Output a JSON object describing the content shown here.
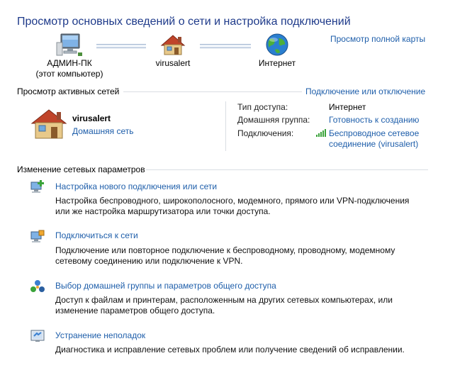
{
  "header": {
    "title": "Просмотр основных сведений о сети и настройка подключений",
    "full_map_link": "Просмотр полной карты"
  },
  "network_map": {
    "computer_name": "АДМИН-ПК",
    "computer_subtitle": "(этот компьютер)",
    "network_name": "virusalert",
    "internet_label": "Интернет"
  },
  "active_networks": {
    "section_title": "Просмотр активных сетей",
    "connect_link": "Подключение или отключение",
    "network": {
      "name": "virusalert",
      "type_link": "Домашняя сеть"
    },
    "properties": {
      "access_type_label": "Тип доступа:",
      "access_type_value": "Интернет",
      "homegroup_label": "Домашняя группа:",
      "homegroup_value": "Готовность к созданию",
      "connections_label": "Подключения:",
      "connection_line1": "Беспроводное сетевое",
      "connection_line2": "соединение (virusalert)"
    }
  },
  "change_settings": {
    "section_title": "Изменение сетевых параметров",
    "tasks": [
      {
        "title": "Настройка нового подключения или сети",
        "desc_line1": "Настройка беспроводного, широкополосного, модемного, прямого или VPN-подключения",
        "desc_line2": "или же настройка маршрутизатора или точки доступа."
      },
      {
        "title": "Подключиться к сети",
        "desc_line1": "Подключение или повторное подключение к беспроводному, проводному, модемному",
        "desc_line2": "сетевому соединению или подключение к VPN."
      },
      {
        "title": "Выбор домашней группы и параметров общего доступа",
        "desc_line1": "Доступ к файлам и принтерам, расположенным на других сетевых компьютерах, или",
        "desc_line2": "изменение параметров общего доступа."
      },
      {
        "title": "Устранение неполадок",
        "desc_line1": "Диагностика и исправление сетевых проблем или получение сведений об исправлении."
      }
    ]
  },
  "colors": {
    "link": "#1e5eaa",
    "title": "#1e3a8a"
  }
}
